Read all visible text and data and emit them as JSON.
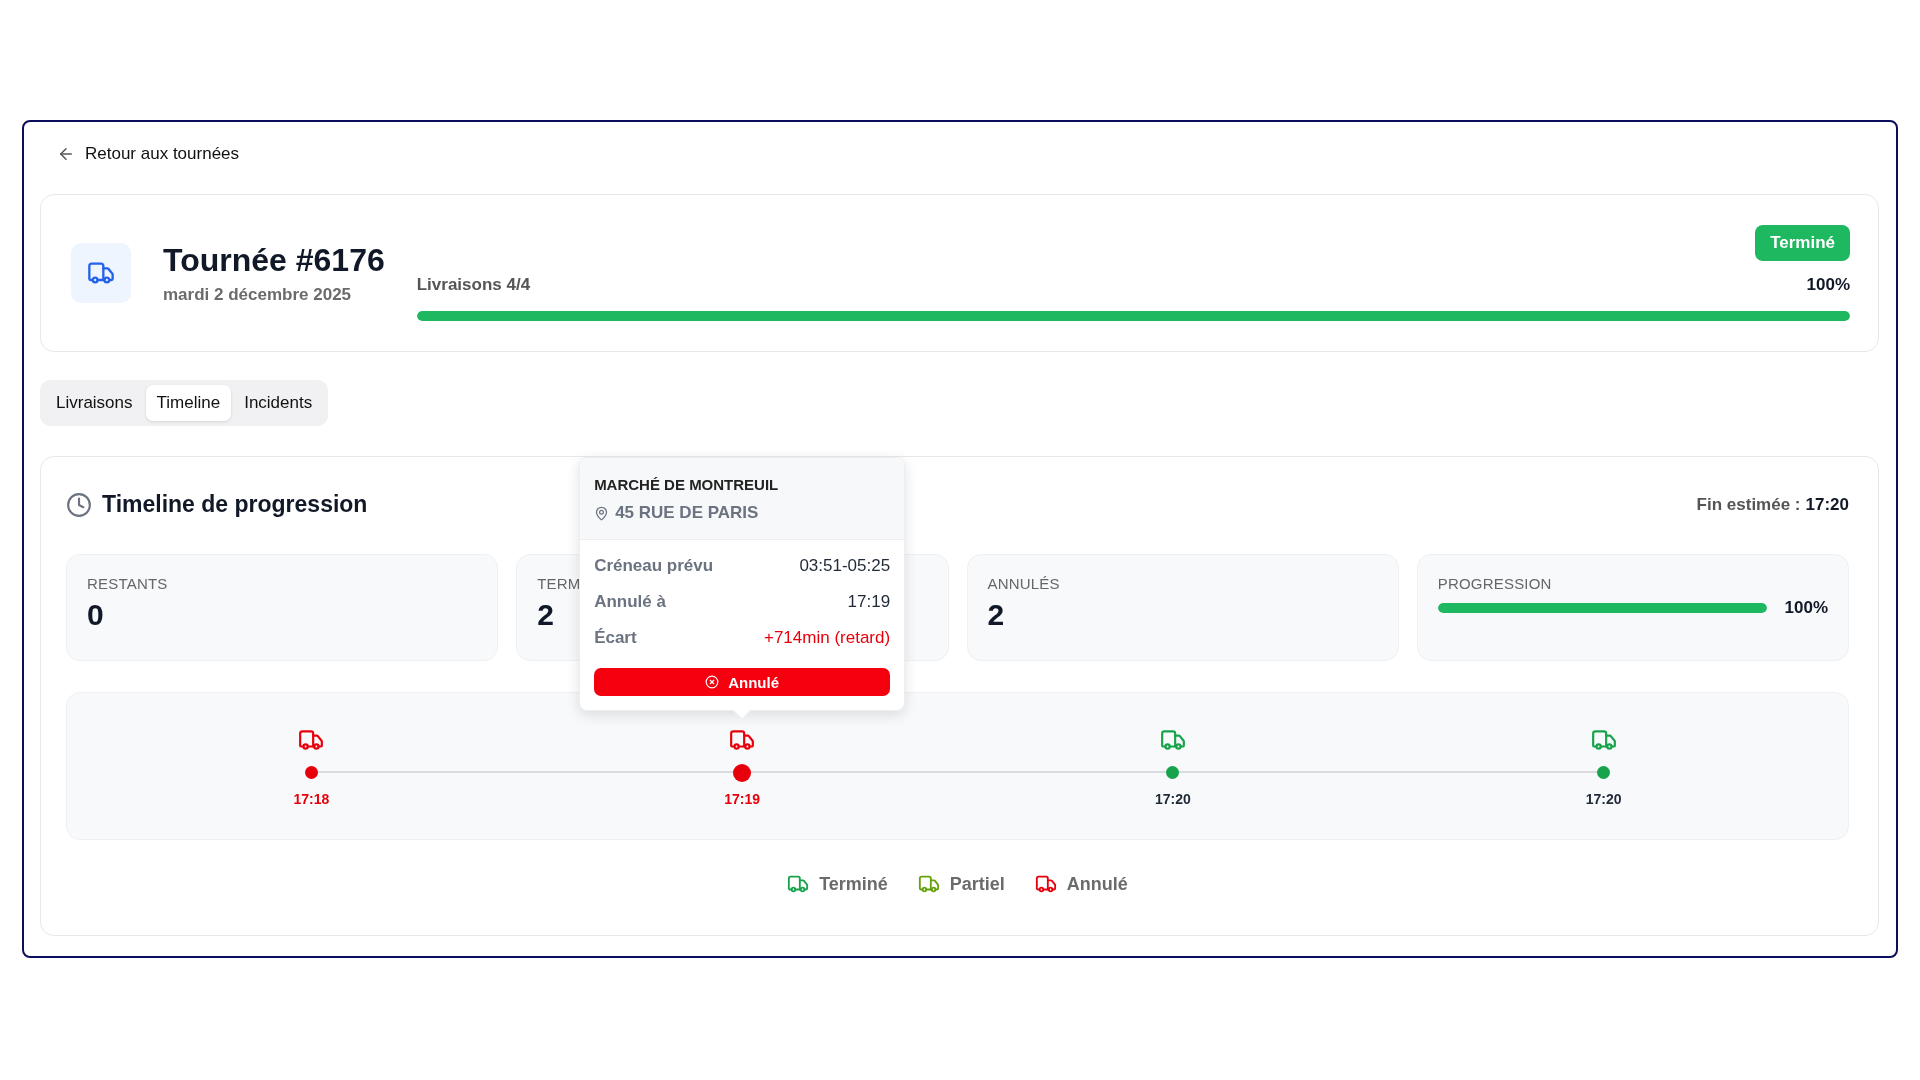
{
  "back_link": "Retour aux tournées",
  "header": {
    "title": "Tournée #6176",
    "date": "mardi 2 décembre 2025",
    "status": {
      "label": "Terminé",
      "kind": "done"
    },
    "progress_label": "Livraisons 4/4",
    "progress_reading": "100%",
    "level": 1
  },
  "tabs": [
    {
      "label": "Livraisons",
      "selected": false
    },
    {
      "label": "Timeline",
      "selected": true
    },
    {
      "label": "Incidents",
      "selected": false
    }
  ],
  "timeline": {
    "title": "Timeline de progression",
    "end_label": "Fin estimée :",
    "end_value": "17:20",
    "stats": [
      {
        "kind": "number",
        "label": "RESTANTS",
        "value": "0"
      },
      {
        "kind": "number",
        "label": "TERM",
        "value": "2"
      },
      {
        "kind": "number",
        "label": "ANNULÉS",
        "value": "2"
      },
      {
        "kind": "progress",
        "label": "PROGRESSION",
        "level": 1,
        "reading": "100%"
      }
    ],
    "stops": [
      {
        "kind": "cancelled",
        "time": "17:18",
        "selected": false
      },
      {
        "kind": "cancelled",
        "time": "17:19",
        "selected": true
      },
      {
        "kind": "done",
        "time": "17:20",
        "selected": false
      },
      {
        "kind": "done",
        "time": "17:20",
        "selected": false
      }
    ],
    "tooltip": {
      "name": "MARCHÉ DE MONTREUIL",
      "address": "45 RUE DE PARIS",
      "rows": [
        {
          "kind": "plain",
          "label": "Créneau prévu",
          "value": "03:51-05:25"
        },
        {
          "kind": "plain",
          "label": "Annulé à",
          "value": "17:19"
        },
        {
          "kind": "delay",
          "label": "Écart",
          "value": "+714min (retard)"
        }
      ],
      "status": {
        "kind": "cancelled",
        "label": "Annulé"
      }
    },
    "legend": [
      {
        "kind": "done",
        "label": "Terminé"
      },
      {
        "kind": "partial",
        "label": "Partiel"
      },
      {
        "kind": "cancelled",
        "label": "Annulé"
      }
    ]
  }
}
